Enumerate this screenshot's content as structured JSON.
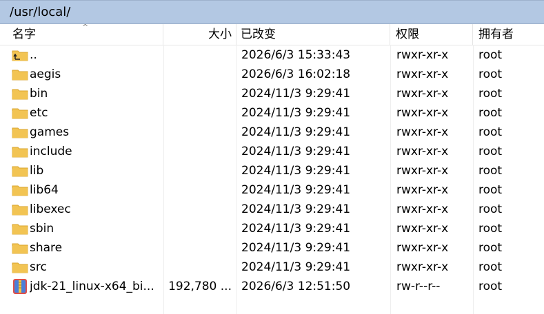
{
  "path": "/usr/local/",
  "columns": {
    "name": "名字",
    "size": "大小",
    "modified": "已改变",
    "permissions": "权限",
    "owner": "拥有者"
  },
  "rows": [
    {
      "name": "..",
      "size": "",
      "modified": "2026/6/3 15:33:43",
      "permissions": "rwxr-xr-x",
      "owner": "root",
      "icon": "parent-folder-icon"
    },
    {
      "name": "aegis",
      "size": "",
      "modified": "2026/6/3 16:02:18",
      "permissions": "rwxr-xr-x",
      "owner": "root",
      "icon": "folder-icon"
    },
    {
      "name": "bin",
      "size": "",
      "modified": "2024/11/3 9:29:41",
      "permissions": "rwxr-xr-x",
      "owner": "root",
      "icon": "folder-icon"
    },
    {
      "name": "etc",
      "size": "",
      "modified": "2024/11/3 9:29:41",
      "permissions": "rwxr-xr-x",
      "owner": "root",
      "icon": "folder-icon"
    },
    {
      "name": "games",
      "size": "",
      "modified": "2024/11/3 9:29:41",
      "permissions": "rwxr-xr-x",
      "owner": "root",
      "icon": "folder-icon"
    },
    {
      "name": "include",
      "size": "",
      "modified": "2024/11/3 9:29:41",
      "permissions": "rwxr-xr-x",
      "owner": "root",
      "icon": "folder-icon"
    },
    {
      "name": "lib",
      "size": "",
      "modified": "2024/11/3 9:29:41",
      "permissions": "rwxr-xr-x",
      "owner": "root",
      "icon": "folder-icon"
    },
    {
      "name": "lib64",
      "size": "",
      "modified": "2024/11/3 9:29:41",
      "permissions": "rwxr-xr-x",
      "owner": "root",
      "icon": "folder-icon"
    },
    {
      "name": "libexec",
      "size": "",
      "modified": "2024/11/3 9:29:41",
      "permissions": "rwxr-xr-x",
      "owner": "root",
      "icon": "folder-icon"
    },
    {
      "name": "sbin",
      "size": "",
      "modified": "2024/11/3 9:29:41",
      "permissions": "rwxr-xr-x",
      "owner": "root",
      "icon": "folder-icon"
    },
    {
      "name": "share",
      "size": "",
      "modified": "2024/11/3 9:29:41",
      "permissions": "rwxr-xr-x",
      "owner": "root",
      "icon": "folder-icon"
    },
    {
      "name": "src",
      "size": "",
      "modified": "2024/11/3 9:29:41",
      "permissions": "rwxr-xr-x",
      "owner": "root",
      "icon": "folder-icon"
    },
    {
      "name": "jdk-21_linux-x64_bi...",
      "size": "192,780 ...",
      "modified": "2026/6/3 12:51:50",
      "permissions": "rw-r--r--",
      "owner": "root",
      "icon": "archive-file-icon"
    }
  ],
  "colors": {
    "path_bar": "#b3c8e3",
    "folder": "#f2c453",
    "archive": "#e0504a"
  }
}
